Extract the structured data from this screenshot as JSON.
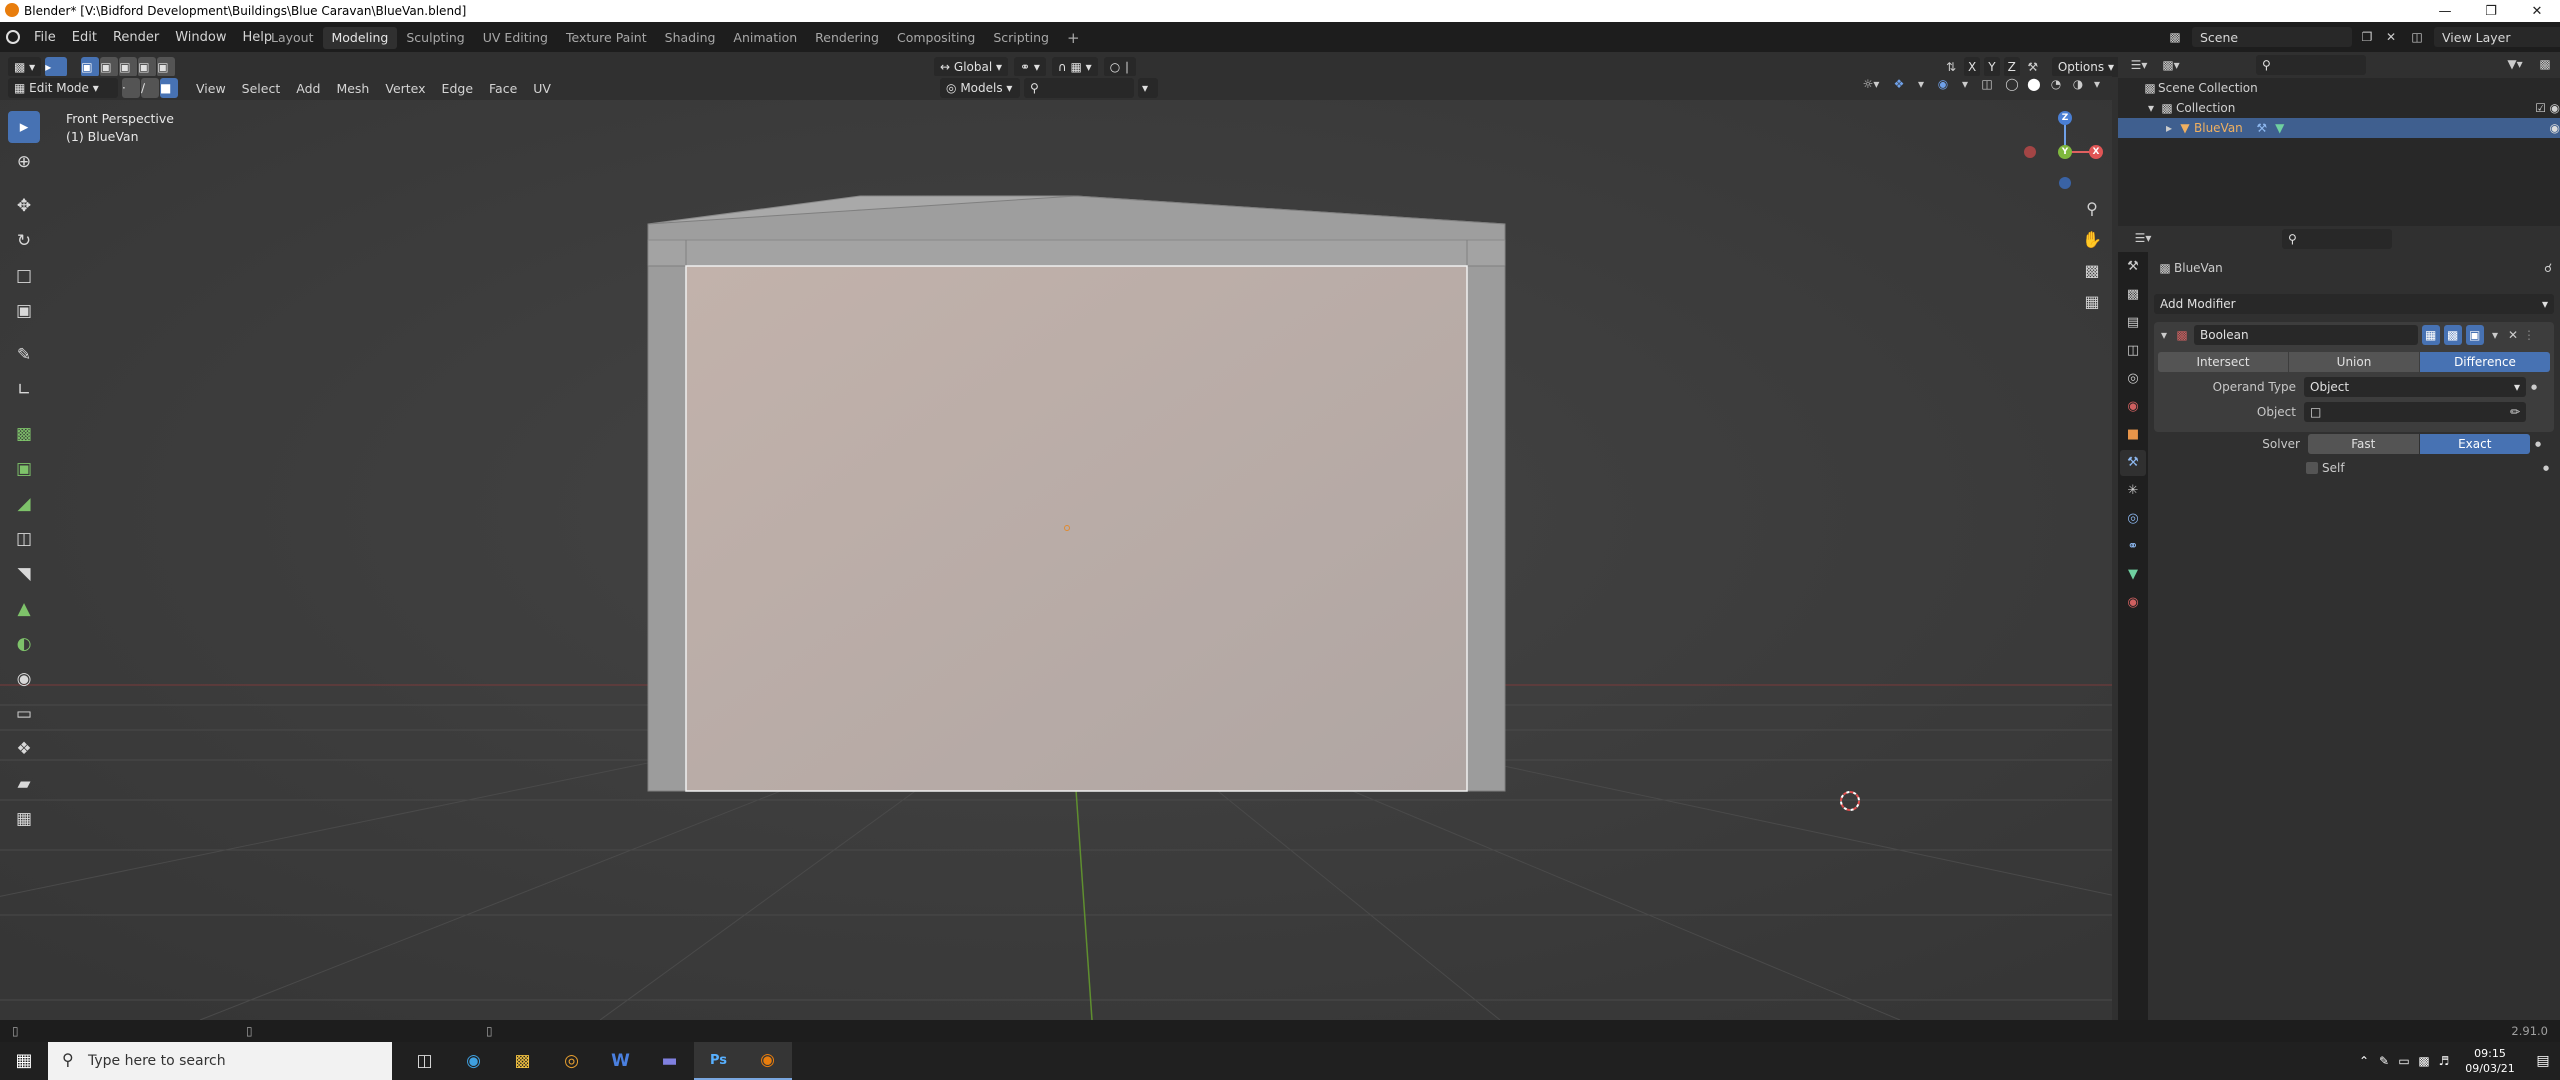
{
  "window": {
    "title": "Blender* [V:\\Bidford Development\\Buildings\\Blue Caravan\\BlueVan.blend]"
  },
  "menu": [
    "File",
    "Edit",
    "Render",
    "Window",
    "Help"
  ],
  "workspaces": [
    "Layout",
    "Modeling",
    "Sculpting",
    "UV Editing",
    "Texture Paint",
    "Shading",
    "Animation",
    "Rendering",
    "Compositing",
    "Scripting"
  ],
  "active_workspace": "Modeling",
  "scene": {
    "label": "Scene",
    "view_layer": "View Layer"
  },
  "viewport_header": {
    "mode": "Edit Mode",
    "menus": [
      "View",
      "Select",
      "Add",
      "Mesh",
      "Vertex",
      "Edge",
      "Face",
      "UV"
    ],
    "orientation": "Global",
    "models": "Models",
    "options": "Options"
  },
  "viewport": {
    "overlay_line1": "Front Perspective",
    "overlay_line2": "(1) BlueVan",
    "gizmo": {
      "x": "X",
      "y": "Y",
      "z": "Z"
    }
  },
  "outliner": {
    "root": "Scene Collection",
    "collection": "Collection",
    "object": "BlueVan"
  },
  "properties": {
    "object_name": "BlueVan",
    "add_modifier": "Add Modifier",
    "modifier_name": "Boolean",
    "operations": [
      "Intersect",
      "Union",
      "Difference"
    ],
    "active_operation": "Difference",
    "operand_type_label": "Operand Type",
    "operand_type_value": "Object",
    "object_label": "Object",
    "solver_label": "Solver",
    "solver_options": [
      "Fast",
      "Exact"
    ],
    "active_solver": "Exact",
    "self_label": "Self"
  },
  "status": {
    "version": "2.91.0"
  },
  "taskbar": {
    "search_placeholder": "Type here to search",
    "time": "09:15",
    "date": "09/03/21"
  },
  "colors": {
    "accent": "#4772b3",
    "viewport_bg": "#3d3d3d",
    "face": "#b9aba6"
  }
}
